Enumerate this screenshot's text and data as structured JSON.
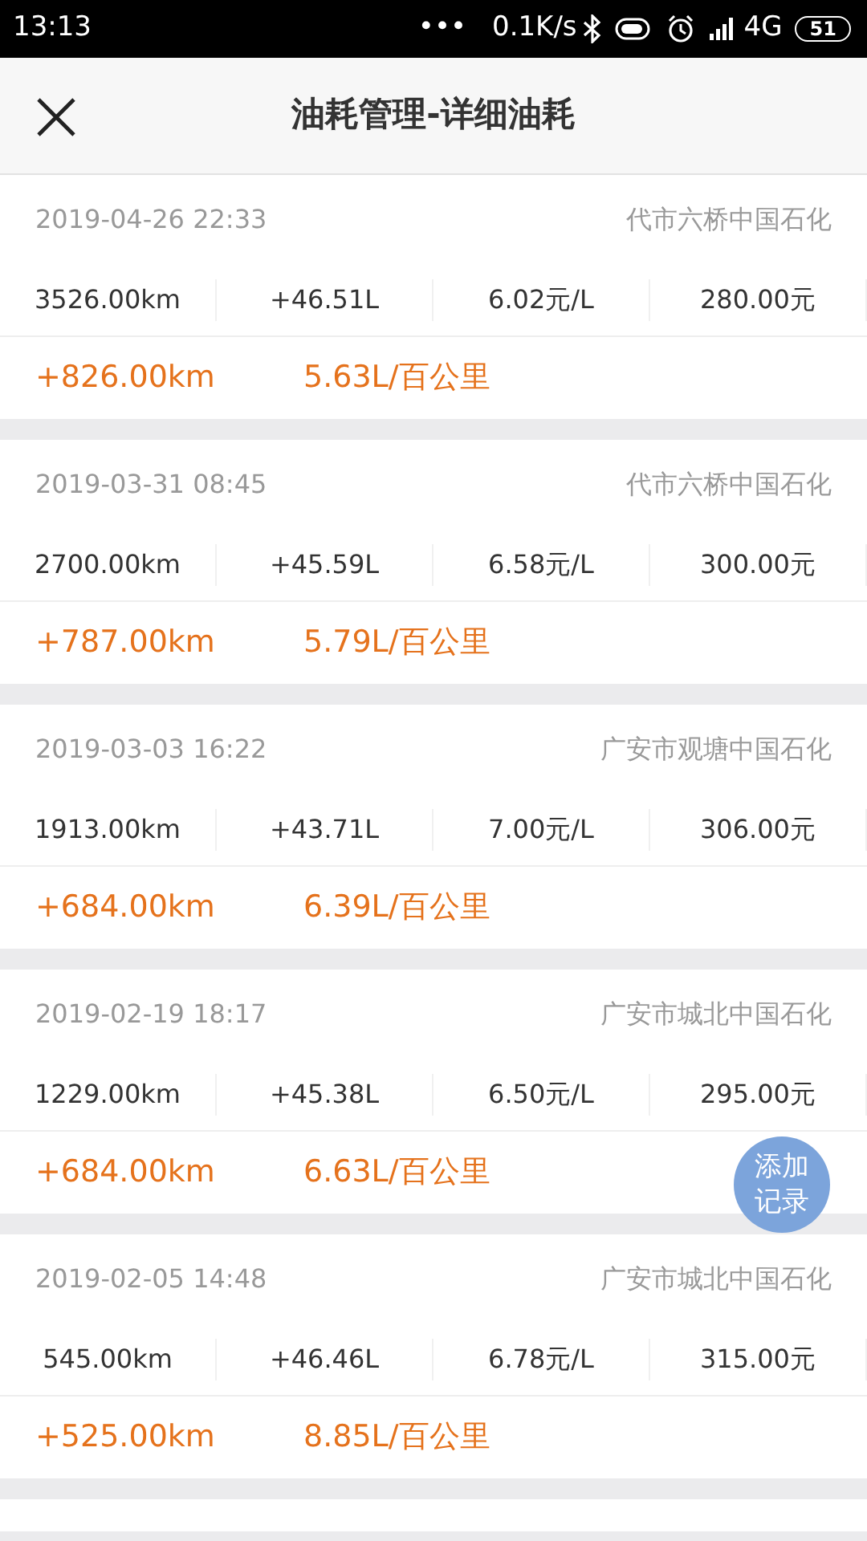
{
  "status_bar": {
    "time": "13:13",
    "more": "•••",
    "speed": "0.1K/s",
    "network": "4G",
    "battery": "51"
  },
  "header": {
    "title": "油耗管理-详细油耗"
  },
  "records": [
    {
      "datetime": "2019-04-26 22:33",
      "station": "代市六桥中国石化",
      "odometer": "3526.00km",
      "fuel": "+46.51L",
      "price": "6.02元/L",
      "cost": "280.00元",
      "distance": "+826.00km",
      "consumption": "5.63L/百公里"
    },
    {
      "datetime": "2019-03-31 08:45",
      "station": "代市六桥中国石化",
      "odometer": "2700.00km",
      "fuel": "+45.59L",
      "price": "6.58元/L",
      "cost": "300.00元",
      "distance": "+787.00km",
      "consumption": "5.79L/百公里"
    },
    {
      "datetime": "2019-03-03 16:22",
      "station": "广安市观塘中国石化",
      "odometer": "1913.00km",
      "fuel": "+43.71L",
      "price": "7.00元/L",
      "cost": "306.00元",
      "distance": "+684.00km",
      "consumption": "6.39L/百公里"
    },
    {
      "datetime": "2019-02-19 18:17",
      "station": "广安市城北中国石化",
      "odometer": "1229.00km",
      "fuel": "+45.38L",
      "price": "6.50元/L",
      "cost": "295.00元",
      "distance": "+684.00km",
      "consumption": "6.63L/百公里"
    },
    {
      "datetime": "2019-02-05 14:48",
      "station": "广安市城北中国石化",
      "odometer": "545.00km",
      "fuel": "+46.46L",
      "price": "6.78元/L",
      "cost": "315.00元",
      "distance": "+525.00km",
      "consumption": "8.85L/百公里"
    }
  ],
  "add_button": {
    "label": "添加记录"
  }
}
